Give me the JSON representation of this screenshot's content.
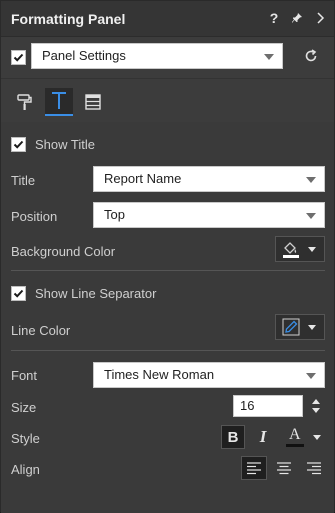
{
  "panel": {
    "title": "Formatting Panel",
    "help_icon": "help-icon",
    "pin_icon": "pin-icon",
    "collapse_icon": "chevron-right-icon"
  },
  "settings": {
    "checked": true,
    "selected": "Panel Settings",
    "reset_icon": "refresh-icon"
  },
  "tabs": [
    {
      "name": "paint-roller-icon",
      "active": false
    },
    {
      "name": "text-format-icon",
      "active": true
    },
    {
      "name": "table-icon",
      "active": false
    }
  ],
  "title_section": {
    "show_title_label": "Show Title",
    "show_title_checked": true,
    "title_label": "Title",
    "title_value": "Report Name",
    "position_label": "Position",
    "position_value": "Top",
    "bg_color_label": "Background Color"
  },
  "separator_section": {
    "show_line_label": "Show Line Separator",
    "show_line_checked": true,
    "line_color_label": "Line Color"
  },
  "font_section": {
    "font_label": "Font",
    "font_value": "Times New Roman",
    "size_label": "Size",
    "size_value": "16",
    "style_label": "Style",
    "bold_label": "B",
    "italic_label": "I",
    "font_color_glyph": "A",
    "align_label": "Align"
  },
  "colors": {
    "panel_bg": "#3c3c3c",
    "title_bar": "#353535",
    "accent": "#3a8ee6"
  }
}
